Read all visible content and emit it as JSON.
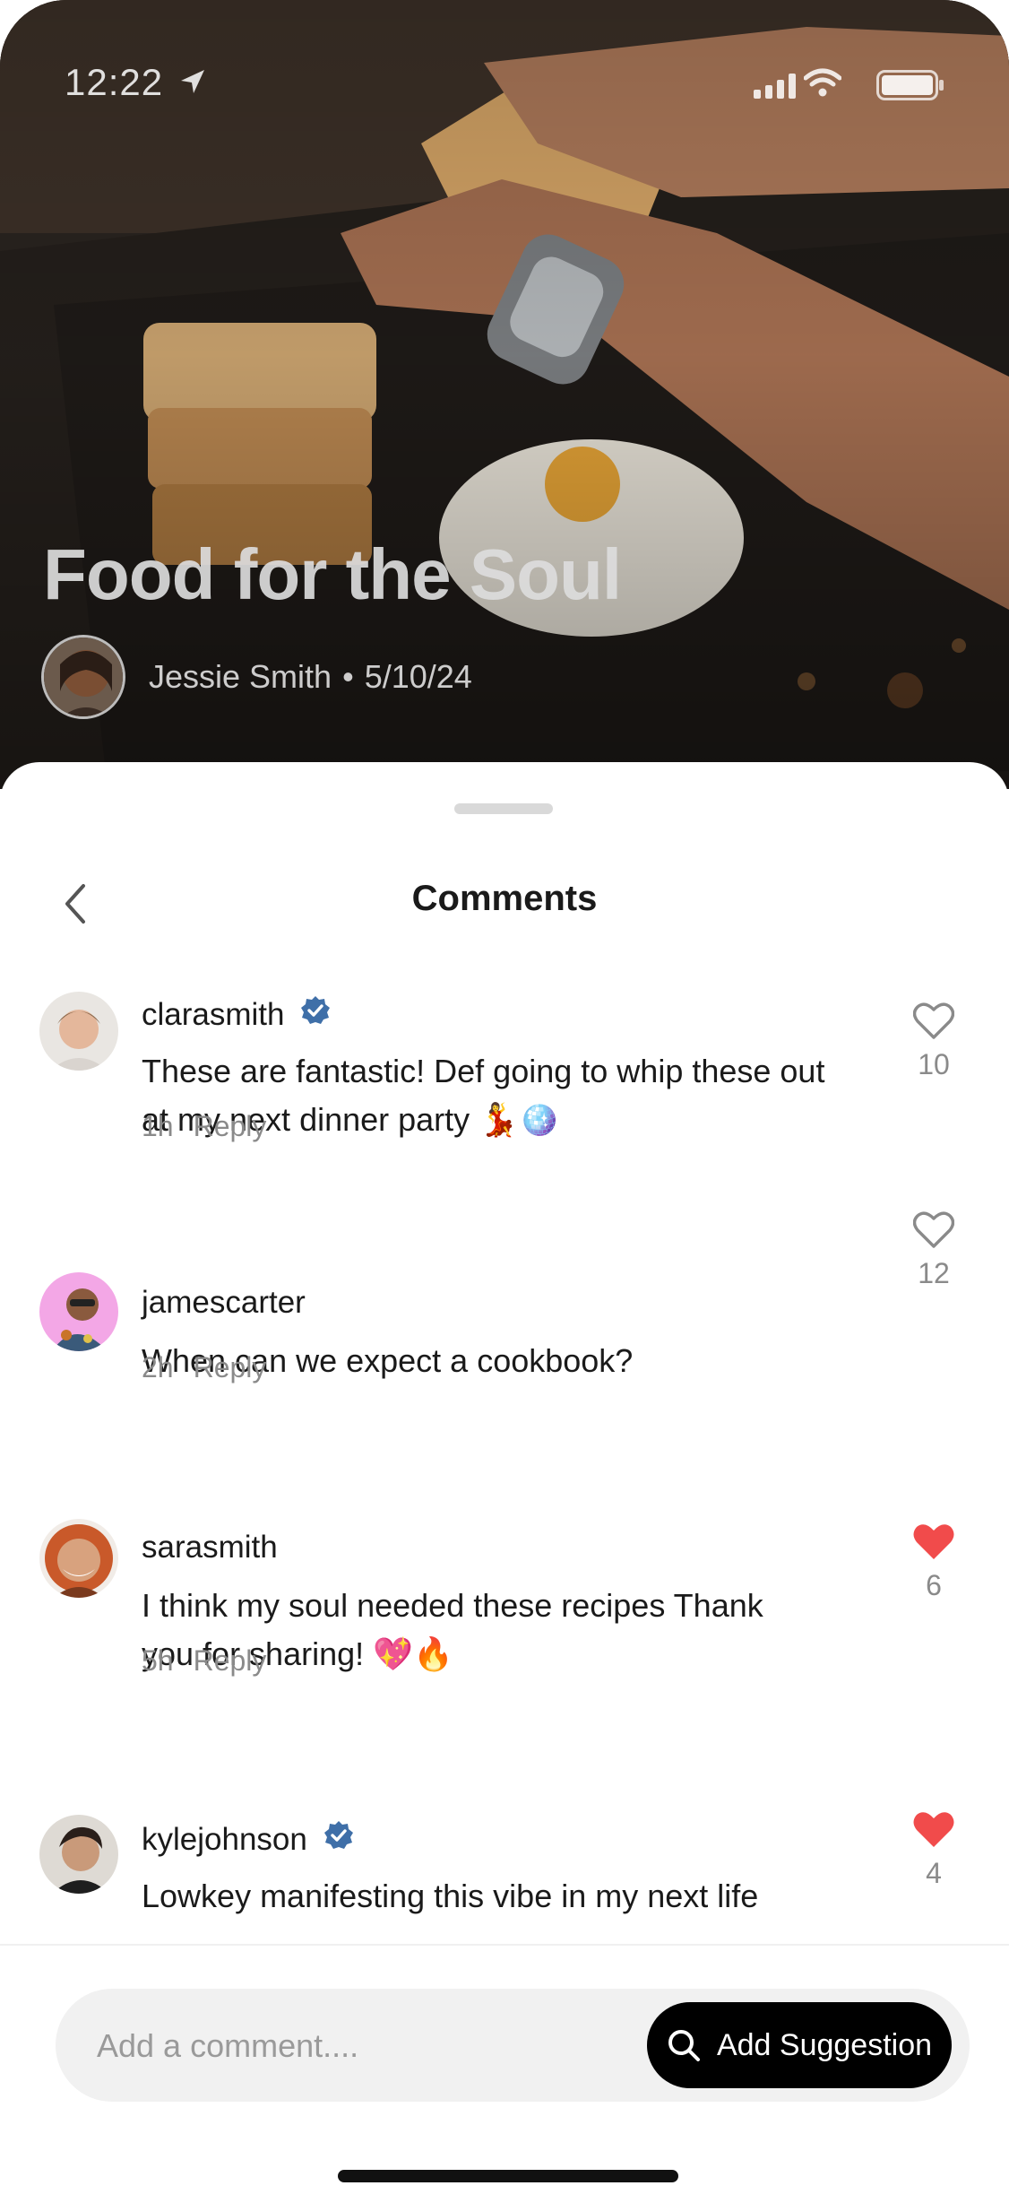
{
  "status_bar": {
    "time": "12:22"
  },
  "post": {
    "title": "Food for the Soul",
    "author": "Jessie Smith",
    "separator": "•",
    "date": "5/10/24"
  },
  "sheet": {
    "title": "Comments"
  },
  "comments": [
    {
      "user": "clarasmith",
      "verified": true,
      "text": "These are fantastic! Def going to whip these out at my next dinner party 💃🪩",
      "time": "1h",
      "reply": "Reply",
      "likes": "10",
      "liked": false
    },
    {
      "user": "jamescarter",
      "verified": false,
      "text": "When can we expect a cookbook?",
      "time": "2h",
      "reply": "Reply",
      "likes": "12",
      "liked": false
    },
    {
      "user": "sarasmith",
      "verified": false,
      "text": "I think my soul needed these recipes Thank you for sharing! 💖🔥",
      "time": "5h",
      "reply": "Reply",
      "likes": "6",
      "liked": true
    },
    {
      "user": "kylejohnson",
      "verified": true,
      "text": "Lowkey manifesting this vibe in my next life",
      "time": "",
      "reply": "",
      "likes": "4",
      "liked": true
    }
  ],
  "input": {
    "placeholder": "Add a comment...."
  },
  "actions": {
    "suggest_label": "Add Suggestion"
  },
  "colors": {
    "like_active": "#f14b4b",
    "verified": "#3f6fa8",
    "button_bg": "#000000"
  }
}
